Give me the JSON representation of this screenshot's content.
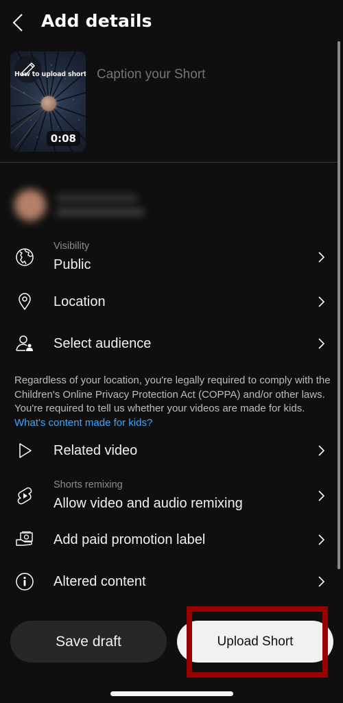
{
  "header": {
    "title": "Add details",
    "back_icon": "chevron-left-icon"
  },
  "video": {
    "thumbnail_title": "How to upload shorts",
    "duration": "0:08",
    "edit_icon": "pencil-icon"
  },
  "caption": {
    "placeholder": "Caption your Short",
    "value": ""
  },
  "account": {
    "name": "(blurred)",
    "handle": "(blurred)"
  },
  "settings": [
    {
      "id": "visibility",
      "icon": "globe-icon",
      "sublabel": "Visibility",
      "label": "Public"
    },
    {
      "id": "location",
      "icon": "location-pin-icon",
      "label": "Location"
    },
    {
      "id": "audience",
      "icon": "audience-icon",
      "label": "Select audience"
    },
    {
      "id": "related-video",
      "icon": "play-outline-icon",
      "label": "Related video"
    },
    {
      "id": "remixing",
      "icon": "shorts-icon",
      "sublabel": "Shorts remixing",
      "label": "Allow video and audio remixing"
    },
    {
      "id": "paid-promotion",
      "icon": "paid-promotion-icon",
      "label": "Add paid promotion label"
    },
    {
      "id": "altered-content",
      "icon": "info-icon",
      "label": "Altered content"
    }
  ],
  "coppa_notice": {
    "text": "Regardless of your location, you're legally required to comply with the Children's Online Privacy Protection Act (COPPA) and/or other laws. You're required to tell us whether your videos are made for kids. ",
    "link_text": "What's content made for kids?"
  },
  "actions": {
    "save_draft": "Save draft",
    "upload": "Upload Short"
  },
  "colors": {
    "background": "#0f0f0f",
    "link": "#3ea6ff",
    "highlight": "#990000",
    "upload_button": "#f1f1f1",
    "save_button": "#272727"
  }
}
